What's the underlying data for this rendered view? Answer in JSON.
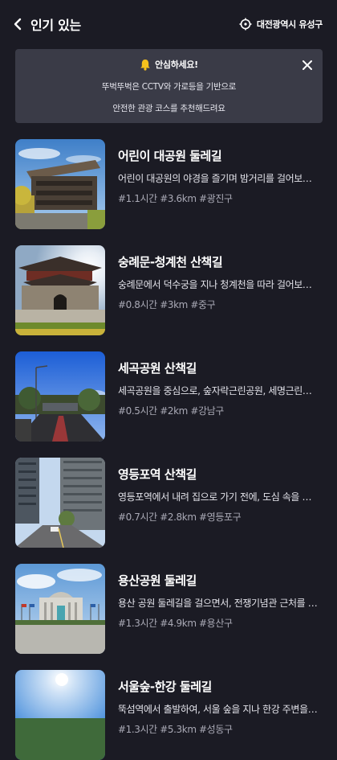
{
  "header": {
    "title": "인기 있는",
    "back_icon": "chevron-left-icon",
    "location_icon": "target-location-icon",
    "location_label": "대전광역시 유성구"
  },
  "notice": {
    "icon": "bell-icon",
    "title": "안심하세요!",
    "line1": "뚜벅뚜벅은 CCTV와 가로등을 기반으로",
    "line2": "안전한 관광 코스를 추천해드려요",
    "close_icon": "close-icon"
  },
  "courses": [
    {
      "title": "어린이 대공원 둘레길",
      "desc": "어린이 대공원의 야경을 즐기며 밤거리를 걸어보세요",
      "tags": "#1.1시간 #3.6km #광진구"
    },
    {
      "title": "숭례문-청계천 산책길",
      "desc": "숭례문에서 덕수궁을 지나 청계천을 따라 걸어보세요",
      "tags": "#0.8시간 #3km #중구"
    },
    {
      "title": "세곡공원 산책길",
      "desc": "세곡공원을 중심으로, 숲자락근린공원, 세명근린공원을 걸어보세요",
      "tags": "#0.5시간 #2km #강남구"
    },
    {
      "title": "영등포역 산책길",
      "desc": "영등포역에서 내려 집으로 가기 전에, 도심 속을 걸어보세요",
      "tags": "#0.7시간 #2.8km #영등포구"
    },
    {
      "title": "용산공원 둘레길",
      "desc": "용산 공원 둘레길을 걸으면서, 전쟁기념관 근처를 걸어보세요",
      "tags": "#1.3시간 #4.9km #용산구"
    },
    {
      "title": "서울숲-한강 둘레길",
      "desc": "뚝섬역에서 출발하여, 서울 숲을 지나 한강 주변을 걸어보세요",
      "tags": "#1.3시간 #5.3km #성동구"
    }
  ]
}
